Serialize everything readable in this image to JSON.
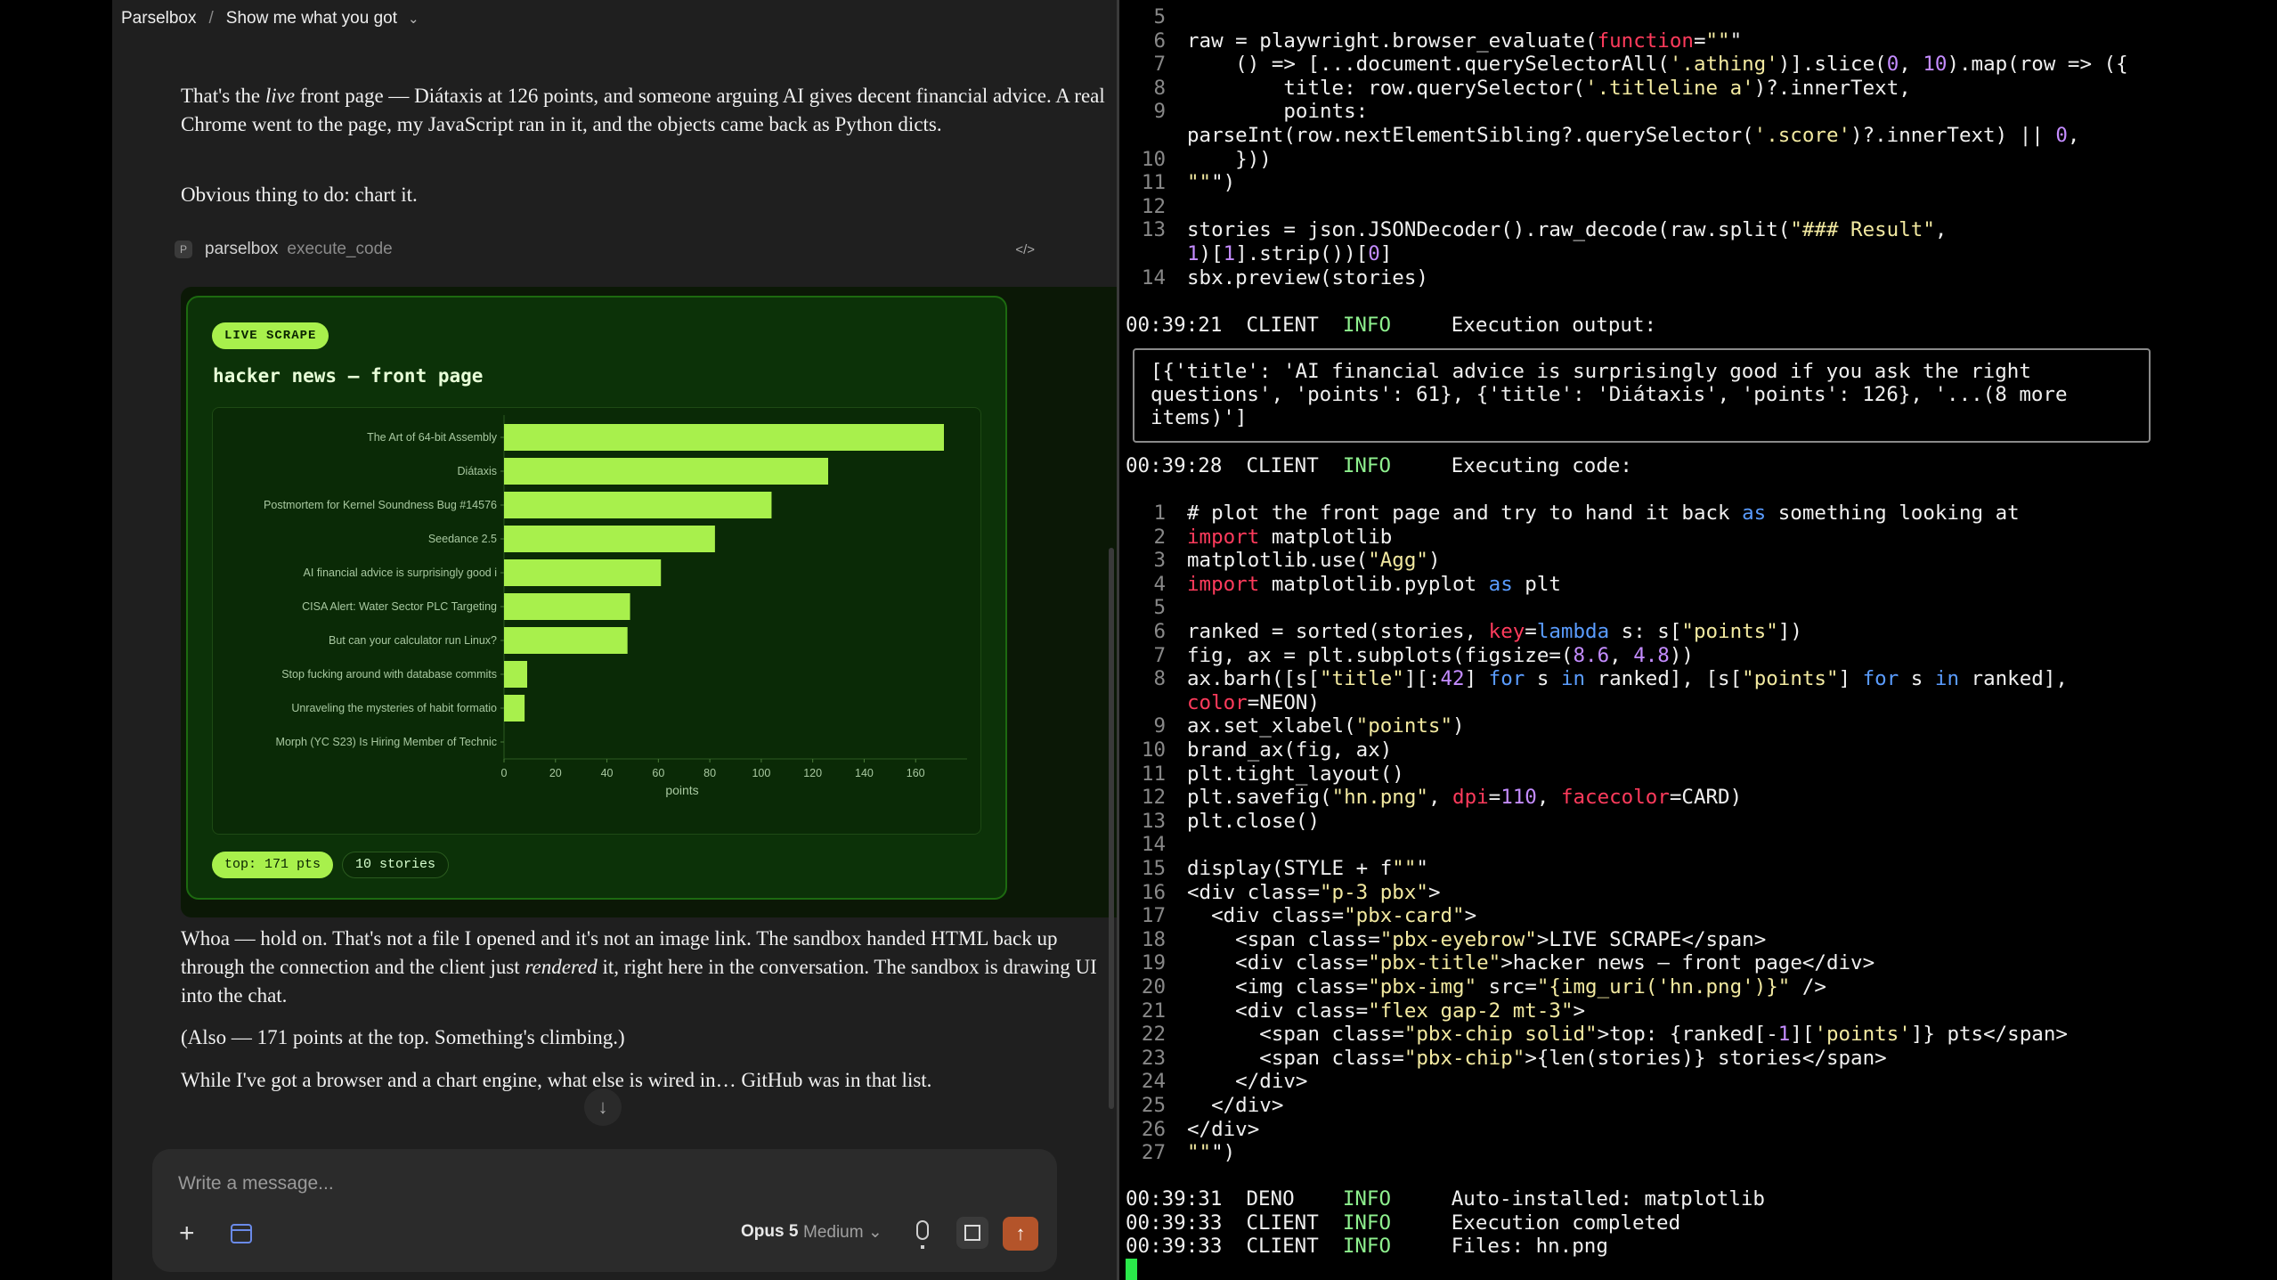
{
  "breadcrumb": {
    "root": "Parselbox",
    "separator": "/",
    "current": "Show me what you got"
  },
  "message_top": {
    "p1_before": "That's the ",
    "p1_em": "live",
    "p1_after": " front page — Diátaxis at 126 points, and someone arguing AI gives decent financial advice. A real Chrome went to the page, my JavaScript ran in it, and the objects came back as Python dicts.",
    "p2": "Obvious thing to do: chart it."
  },
  "tool_call": {
    "badge": "P",
    "name": "parselbox",
    "function": "execute_code",
    "toggle_icon": "</>"
  },
  "card": {
    "eyebrow": "LIVE SCRAPE",
    "title": "hacker news — front page",
    "chip_top": "top: 171 pts",
    "chip_count": "10 stories"
  },
  "chart_data": {
    "type": "bar",
    "orientation": "horizontal",
    "categories": [
      "The Art of 64-bit Assembly",
      "Diátaxis",
      "Postmortem for Kernel Soundness Bug #14576",
      "Seedance 2.5",
      "AI financial advice is surprisingly good i",
      "CISA Alert: Water Sector PLC Targeting",
      "But can your calculator run Linux?",
      "Stop fucking around with database commits",
      "Unraveling the mysteries of habit formatio",
      "Morph (YC S23) Is Hiring Member of Technic"
    ],
    "values": [
      171,
      126,
      104,
      82,
      61,
      49,
      48,
      9,
      8,
      0
    ],
    "xlabel": "points",
    "xticks": [
      0,
      20,
      40,
      60,
      80,
      100,
      120,
      140,
      160
    ],
    "xlim": [
      0,
      180
    ],
    "bar_color": "#a8f04c",
    "background": "#0a2a06"
  },
  "message_bottom": {
    "p3_before": "Whoa — hold on. That's not a file I opened and it's not an image link. The sandbox handed HTML back up through the connection and the client just ",
    "p3_em": "rendered",
    "p3_after": " it, right here in the conversation. The sandbox is drawing UI into the chat.",
    "p4": "(Also — 171 points at the top. Something's climbing.)",
    "p5": "While I've got a browser and a chart engine, what else is wired in… GitHub was in that list."
  },
  "composer": {
    "placeholder": "Write a message...",
    "model": "Opus 5",
    "effort": "Medium"
  },
  "terminal": {
    "code_top": [
      {
        "n": "5",
        "t": ""
      },
      {
        "n": "6",
        "t": "raw = playwright.browser_evaluate(function=\"\"\""
      },
      {
        "n": "7",
        "t": "    () => [...document.querySelectorAll('.athing')].slice(0, 10).map(row => ({"
      },
      {
        "n": "8",
        "t": "        title: row.querySelector('.titleline a')?.innerText,"
      },
      {
        "n": "9",
        "t": "        points:"
      },
      {
        "n": "",
        "t": "parseInt(row.nextElementSibling?.querySelector('.score')?.innerText) || 0,"
      },
      {
        "n": "10",
        "t": "    }))"
      },
      {
        "n": "11",
        "t": "\"\"\")"
      },
      {
        "n": "12",
        "t": ""
      },
      {
        "n": "13",
        "t": "stories = json.JSONDecoder().raw_decode(raw.split(\"### Result\","
      },
      {
        "n": "",
        "t": "1)[1].strip())[0]"
      },
      {
        "n": "14",
        "t": "sbx.preview(stories)"
      }
    ],
    "log1": {
      "time": "00:39:21",
      "src": "CLIENT",
      "level": "INFO",
      "msg": "Execution output:"
    },
    "output": [
      "[{'title': 'AI financial advice is surprisingly good if you ask the right",
      "questions', 'points': 61}, {'title': 'Diátaxis', 'points': 126}, '...(8 more",
      "items)']"
    ],
    "log2": {
      "time": "00:39:28",
      "src": "CLIENT",
      "level": "INFO",
      "msg": "Executing code:"
    },
    "code_bottom": [
      {
        "n": "1",
        "t": "# plot the front page and try to hand it back as something looking at"
      },
      {
        "n": "2",
        "t": "import matplotlib"
      },
      {
        "n": "3",
        "t": "matplotlib.use(\"Agg\")"
      },
      {
        "n": "4",
        "t": "import matplotlib.pyplot as plt"
      },
      {
        "n": "5",
        "t": ""
      },
      {
        "n": "6",
        "t": "ranked = sorted(stories, key=lambda s: s[\"points\"])"
      },
      {
        "n": "7",
        "t": "fig, ax = plt.subplots(figsize=(8.6, 4.8))"
      },
      {
        "n": "8",
        "t": "ax.barh([s[\"title\"][:42] for s in ranked], [s[\"points\"] for s in ranked],"
      },
      {
        "n": "",
        "t": "color=NEON)"
      },
      {
        "n": "9",
        "t": "ax.set_xlabel(\"points\")"
      },
      {
        "n": "10",
        "t": "brand_ax(fig, ax)"
      },
      {
        "n": "11",
        "t": "plt.tight_layout()"
      },
      {
        "n": "12",
        "t": "plt.savefig(\"hn.png\", dpi=110, facecolor=CARD)"
      },
      {
        "n": "13",
        "t": "plt.close()"
      },
      {
        "n": "14",
        "t": ""
      },
      {
        "n": "15",
        "t": "display(STYLE + f\"\"\""
      },
      {
        "n": "16",
        "t": "<div class=\"p-3 pbx\">"
      },
      {
        "n": "17",
        "t": "  <div class=\"pbx-card\">"
      },
      {
        "n": "18",
        "t": "    <span class=\"pbx-eyebrow\">LIVE SCRAPE</span>"
      },
      {
        "n": "19",
        "t": "    <div class=\"pbx-title\">hacker news — front page</div>"
      },
      {
        "n": "20",
        "t": "    <img class=\"pbx-img\" src=\"{img_uri('hn.png')}\" />"
      },
      {
        "n": "21",
        "t": "    <div class=\"flex gap-2 mt-3\">"
      },
      {
        "n": "22",
        "t": "      <span class=\"pbx-chip solid\">top: {ranked[-1]['points']} pts</span>"
      },
      {
        "n": "23",
        "t": "      <span class=\"pbx-chip\">{len(stories)} stories</span>"
      },
      {
        "n": "24",
        "t": "    </div>"
      },
      {
        "n": "25",
        "t": "  </div>"
      },
      {
        "n": "26",
        "t": "</div>"
      },
      {
        "n": "27",
        "t": "\"\"\")"
      }
    ],
    "logs_end": [
      {
        "time": "00:39:31",
        "src": "DENO",
        "level": "INFO",
        "msg": "Auto-installed: matplotlib"
      },
      {
        "time": "00:39:33",
        "src": "CLIENT",
        "level": "INFO",
        "msg": "Execution completed"
      },
      {
        "time": "00:39:33",
        "src": "CLIENT",
        "level": "INFO",
        "msg": "Files: hn.png"
      }
    ]
  }
}
